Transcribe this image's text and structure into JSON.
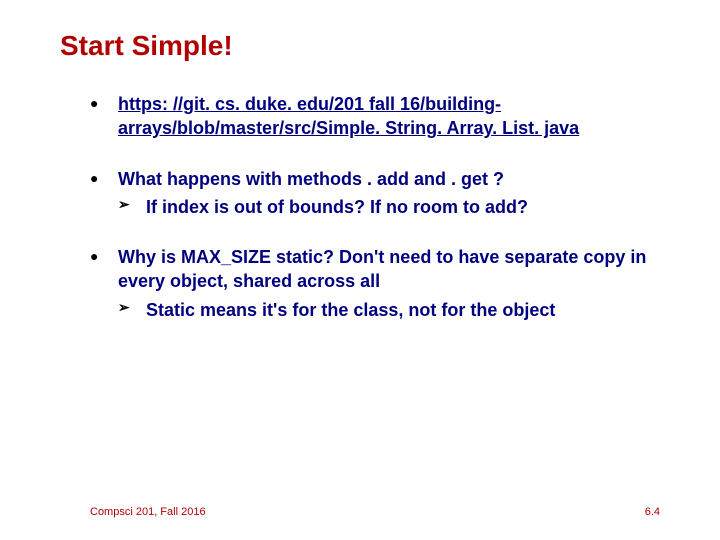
{
  "title": "Start Simple!",
  "bullets": {
    "b1": {
      "link": "https: //git. cs. duke. edu/201 fall 16/building-arrays/blob/master/src/Simple. String. Array. List. java"
    },
    "b2": {
      "text": "What happens with methods . add and . get ?",
      "sub1": "If index is out of bounds? If no room to add?"
    },
    "b3": {
      "text": "Why is MAX_SIZE static? Don't need to have separate copy in every object, shared across all",
      "sub1": "Static means it's for the class, not for the object"
    }
  },
  "footer": {
    "left": "Compsci 201, Fall 2016",
    "right": "6.4"
  }
}
